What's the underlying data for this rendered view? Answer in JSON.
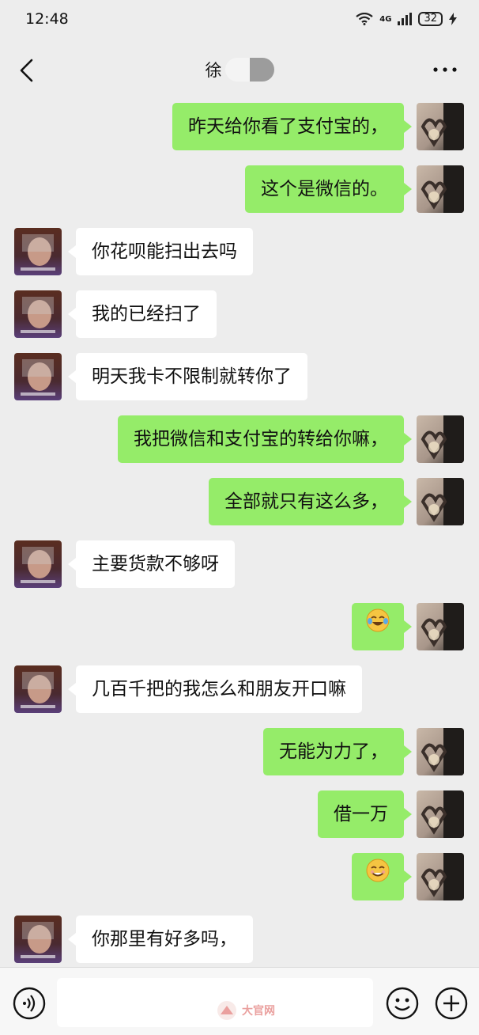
{
  "status_bar": {
    "time": "12:48",
    "network": "4G",
    "battery": "32"
  },
  "header": {
    "title": "徐"
  },
  "messages": [
    {
      "from": "self",
      "text": "昨天给你看了支付宝的，"
    },
    {
      "from": "self",
      "text": "这个是微信的。"
    },
    {
      "from": "other",
      "text": "你花呗能扫出去吗"
    },
    {
      "from": "other",
      "text": "我的已经扫了"
    },
    {
      "from": "other",
      "text": "明天我卡不限制就转你了"
    },
    {
      "from": "self",
      "text": "我把微信和支付宝的转给你嘛，"
    },
    {
      "from": "self",
      "text": "全部就只有这么多，"
    },
    {
      "from": "other",
      "text": "主要货款不够呀"
    },
    {
      "from": "self",
      "emoji": "crying-laughing-emoji"
    },
    {
      "from": "other",
      "text": "几百千把的我怎么和朋友开口嘛"
    },
    {
      "from": "self",
      "text": "无能为力了，"
    },
    {
      "from": "self",
      "text": "借一万"
    },
    {
      "from": "self",
      "emoji": "grinning-emoji"
    },
    {
      "from": "other",
      "text": "你那里有好多吗，"
    }
  ],
  "watermark": {
    "text": "大官网"
  },
  "colors": {
    "self_bubble": "#95ec69",
    "other_bubble": "#ffffff",
    "background": "#ededed"
  }
}
